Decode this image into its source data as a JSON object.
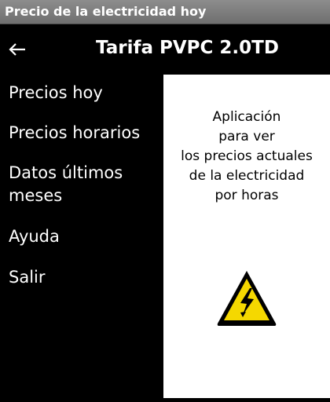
{
  "window": {
    "title": "Precio de la electricidad hoy"
  },
  "appbar": {
    "back_icon": "arrow-left-icon",
    "title": "Tarifa PVPC 2.0TD"
  },
  "menu": {
    "items": [
      {
        "label": "Precios hoy"
      },
      {
        "label": "Precios horarios"
      },
      {
        "label": "Datos últimos"
      },
      {
        "label": "meses"
      },
      {
        "label": "Ayuda"
      },
      {
        "label": "Salir"
      }
    ]
  },
  "content": {
    "description_lines": [
      "Aplicación",
      "para ver",
      "los precios actuales",
      "de la electricidad",
      "por horas"
    ],
    "icon": "high-voltage-warning-icon"
  },
  "colors": {
    "titlebar": "#7f7f7f",
    "background": "#000000",
    "content_background": "#ffffff",
    "warning_yellow": "#f5d800"
  }
}
